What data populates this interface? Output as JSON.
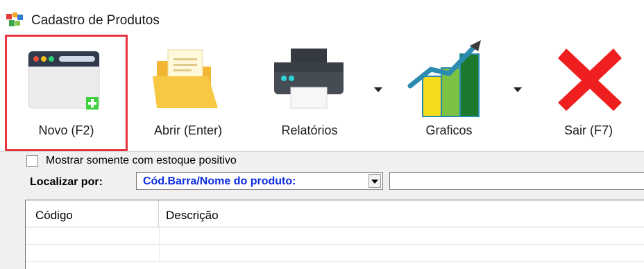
{
  "window": {
    "title": "Cadastro de Produtos"
  },
  "toolbar": {
    "buttons": [
      {
        "label": "Novo (F2)",
        "icon": "new-window-icon",
        "selected": true
      },
      {
        "label": "Abrir (Enter)",
        "icon": "folder-open-icon"
      },
      {
        "label": "Relatórios",
        "icon": "printer-icon",
        "has_dropdown": true
      },
      {
        "label": "Graficos",
        "icon": "bar-chart-icon",
        "has_dropdown": true
      },
      {
        "label": "Sair (F7)",
        "icon": "close-x-icon"
      }
    ]
  },
  "filters": {
    "positive_stock_label": "Mostrar somente com estoque positivo",
    "positive_stock_checked": false,
    "search_label": "Localizar por:",
    "search_by_value": "Cód.Barra/Nome do produto:",
    "search_text": ""
  },
  "grid": {
    "columns": [
      "Código",
      "Descrição"
    ],
    "rows": []
  },
  "colors": {
    "selection_outline": "#e8353d",
    "combo_text": "#0a2be0",
    "close_red": "#ef1f1f"
  }
}
